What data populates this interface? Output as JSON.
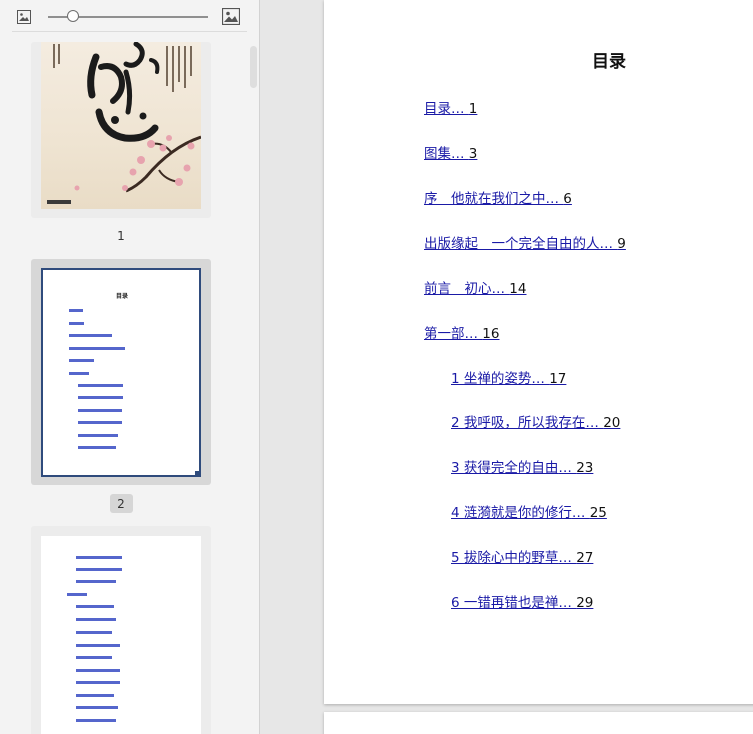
{
  "sidebar": {
    "thumbnails": [
      {
        "page_label": "1"
      },
      {
        "page_label": "2"
      }
    ],
    "mini_toc": {
      "title": "目录"
    }
  },
  "document": {
    "title": "目录",
    "toc": [
      {
        "label": "目录",
        "page": "1"
      },
      {
        "label": "图集",
        "page": "3"
      },
      {
        "label": "序　他就在我们之中",
        "page": "6"
      },
      {
        "label": "出版缘起　一个完全自由的人",
        "page": "9"
      },
      {
        "label": "前言　初心",
        "page": "14"
      },
      {
        "label": "第一部",
        "page": "16"
      },
      {
        "label": "1 坐禅的姿势",
        "page": "17"
      },
      {
        "label": "2 我呼吸，所以我存在",
        "page": "20"
      },
      {
        "label": "3 获得完全的自由",
        "page": "23"
      },
      {
        "label": "4 涟漪就是你的修行",
        "page": "25"
      },
      {
        "label": "5 拔除心中的野草",
        "page": "27"
      },
      {
        "label": "6 一错再错也是禅",
        "page": "29"
      }
    ]
  },
  "colors": {
    "link": "#1a1aa6",
    "sidebar_bg": "#f3f3f3",
    "selected_thumb": "#d7d7d7"
  },
  "icons": {
    "zoom_out": "image-small-icon",
    "zoom_in": "image-large-icon"
  }
}
